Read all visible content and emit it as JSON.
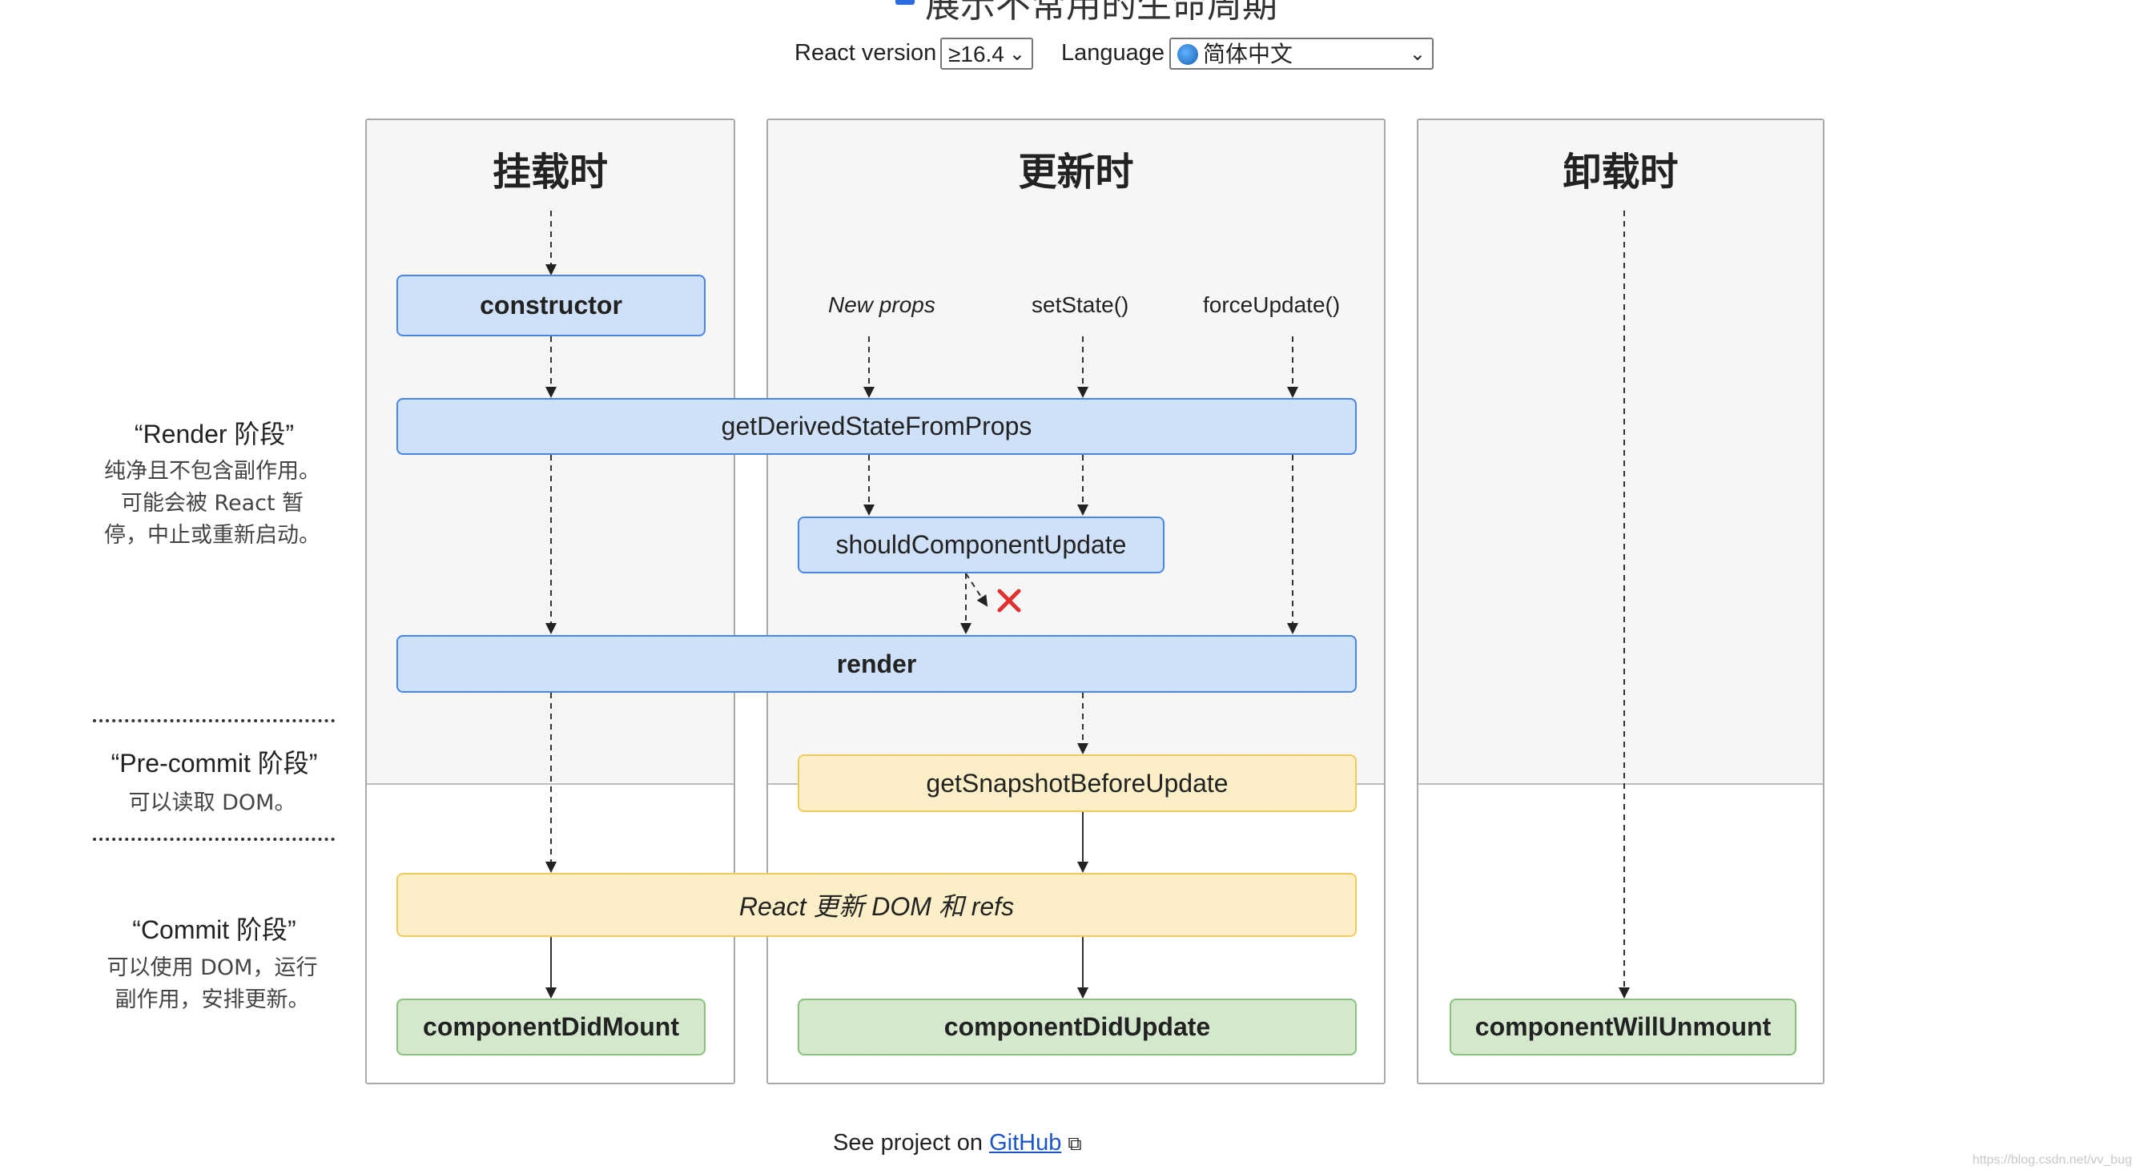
{
  "header": {
    "title": "展示不常用的生命周期"
  },
  "controls": {
    "react_version_label": "React version",
    "react_version_value": "≥16.4",
    "language_label": "Language",
    "language_value": "简体中文",
    "language_icon": "globe-icon"
  },
  "columns": {
    "mount": "挂载时",
    "update": "更新时",
    "unmount": "卸载时"
  },
  "triggers": {
    "new_props": "New props",
    "set_state": "setState()",
    "force_update": "forceUpdate()"
  },
  "methods": {
    "constructor": "constructor",
    "get_derived_state": "getDerivedStateFromProps",
    "should_update": "shouldComponentUpdate",
    "render": "render",
    "snapshot": "getSnapshotBeforeUpdate",
    "react_updates_dom": "React 更新 DOM 和 refs",
    "did_mount": "componentDidMount",
    "did_update": "componentDidUpdate",
    "will_unmount": "componentWillUnmount"
  },
  "phases": {
    "render_title": "“Render 阶段”",
    "render_desc": [
      "纯净且不包含副作用。",
      "可能会被 React 暂",
      "停，中止或重新启动。"
    ],
    "precommit_title": "“Pre-commit 阶段”",
    "precommit_desc": "可以读取 DOM。",
    "commit_title": "“Commit 阶段”",
    "commit_desc": [
      "可以使用 DOM，运行",
      "副作用，安排更新。"
    ]
  },
  "footer": {
    "prefix": "See project on",
    "link": "GitHub"
  },
  "watermark": "https://blog.csdn.net/vv_bug",
  "colors": {
    "blue_fill": "#cfe0f9",
    "blue_border": "#4a86e8",
    "yellow_fill": "#fcefc7",
    "green_fill": "#d4e8cd",
    "cancel_mark": "#e03131"
  }
}
